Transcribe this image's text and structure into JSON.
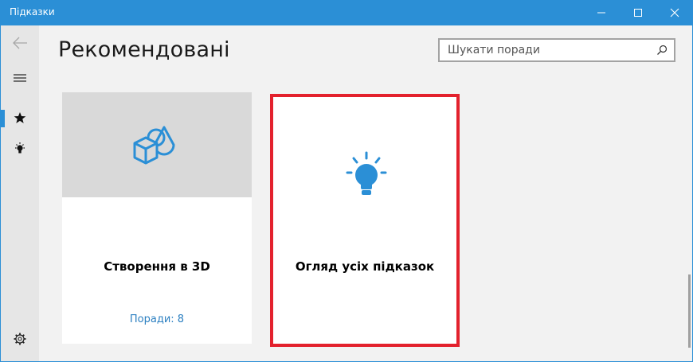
{
  "window": {
    "title": "Підказки"
  },
  "header": {
    "page_title": "Рекомендовані"
  },
  "search": {
    "placeholder": "Шукати поради",
    "value": ""
  },
  "nav": {
    "items": [
      {
        "icon": "back-arrow-icon"
      },
      {
        "icon": "hamburger-menu-icon"
      },
      {
        "icon": "star-icon",
        "selected": true
      },
      {
        "icon": "lightbulb-icon"
      },
      {
        "icon": "settings-gear-icon"
      }
    ]
  },
  "cards": [
    {
      "title": "Створення в 3D",
      "link": "Поради: 8",
      "icon": "3d-shapes-icon"
    },
    {
      "title": "Огляд усіх підказок",
      "icon": "lightbulb-icon",
      "highlighted": true
    }
  ],
  "colors": {
    "accent": "#2b8fd6",
    "highlight_border": "#e3212d",
    "link": "#2b7fc1"
  }
}
